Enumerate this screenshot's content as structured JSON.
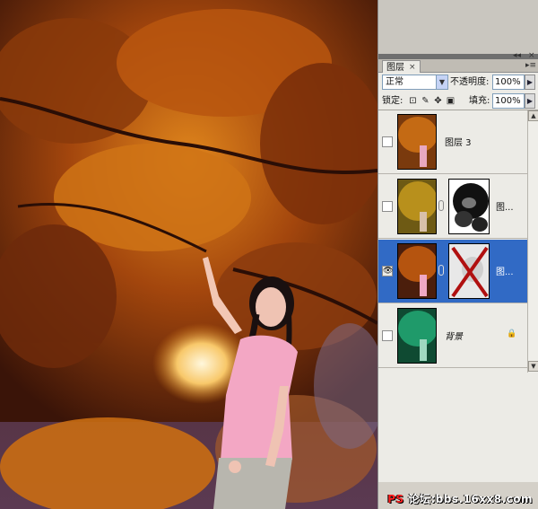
{
  "panel": {
    "tab_label": "图层",
    "tab_close": "×",
    "menu_icon": "panel-menu-icon",
    "window_minimize": "◂◂",
    "window_close": "×",
    "blend_mode": "正常",
    "opacity_label": "不透明度:",
    "opacity_value": "100%",
    "lock_label": "锁定:",
    "fill_label": "填充:",
    "fill_value": "100%",
    "layers": [
      {
        "name": "图层 3",
        "visible": false,
        "has_mask": false,
        "selected": false
      },
      {
        "name": "图...",
        "visible": false,
        "has_mask": true,
        "selected": false
      },
      {
        "name": "图...",
        "visible": true,
        "has_mask": true,
        "selected": true
      },
      {
        "name": "背景",
        "visible": false,
        "has_mask": false,
        "selected": false,
        "locked": true
      }
    ]
  },
  "watermark": {
    "ps": "PS",
    "text": "论坛:bbs.16xx8.com"
  },
  "colors": {
    "selection": "#316ac5",
    "panel_bg": "#ecebe6",
    "foliage": "#b4520f",
    "background_layer": "#1a7a52"
  }
}
